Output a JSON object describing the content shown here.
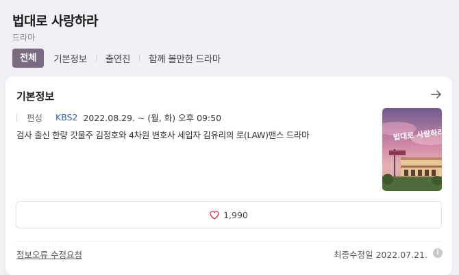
{
  "program": {
    "title": "법대로 사랑하라",
    "genre": "드라마"
  },
  "tabs": [
    {
      "label": "전체",
      "active": true
    },
    {
      "label": "기본정보",
      "active": false
    },
    {
      "label": "출연진",
      "active": false
    },
    {
      "label": "함께 볼만한 드라마",
      "active": false
    }
  ],
  "basic_info": {
    "section_title": "기본정보",
    "schedule_label": "편성",
    "channel": "KBS2",
    "airtime": "2022.08.29. ~  (월, 화) 오후 09:50",
    "description": "검사 출신 한량 갓물주 김정호와 4차원 변호사 세입자 김유리의 로(LAW)맨스 드라마",
    "poster_title": "법대로 사랑하라"
  },
  "likes": {
    "count": "1,990",
    "icon": "heart-outline-icon"
  },
  "footer": {
    "report_label": "정보오류 수정요청",
    "updated_label": "최종수정일 2022.07.21."
  },
  "colors": {
    "active_tab": "#7a6a82",
    "channel": "#2d60b4",
    "heart": "#e0354b"
  }
}
